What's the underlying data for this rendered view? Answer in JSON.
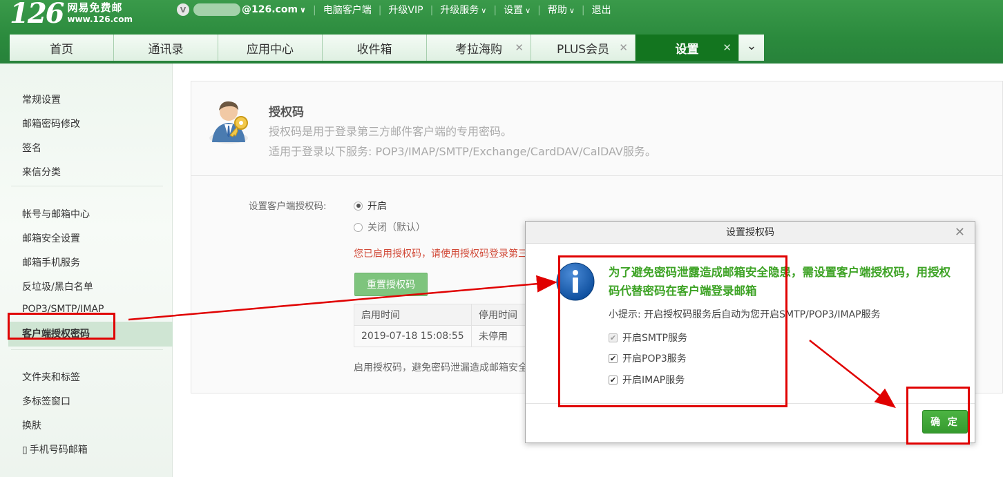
{
  "header": {
    "logo_number": "126",
    "logo_name": "网易免费邮",
    "logo_url": "www.126.com",
    "vip_badge": "V",
    "account_suffix": "@126.com",
    "links": [
      {
        "label": "电脑客户端",
        "dropdown": false
      },
      {
        "label": "升级VIP",
        "dropdown": false
      },
      {
        "label": "升级服务",
        "dropdown": true
      },
      {
        "label": "设置",
        "dropdown": true
      },
      {
        "label": "帮助",
        "dropdown": true
      },
      {
        "label": "退出",
        "dropdown": false
      }
    ]
  },
  "tabs": [
    {
      "label": "首页",
      "closable": false,
      "active": false
    },
    {
      "label": "通讯录",
      "closable": false,
      "active": false
    },
    {
      "label": "应用中心",
      "closable": false,
      "active": false
    },
    {
      "label": "收件箱",
      "closable": false,
      "active": false
    },
    {
      "label": "考拉海购",
      "closable": true,
      "active": false
    },
    {
      "label": "PLUS会员",
      "closable": true,
      "active": false
    },
    {
      "label": "设置",
      "closable": true,
      "active": true
    }
  ],
  "sidebar": {
    "groups": [
      [
        "常规设置",
        "邮箱密码修改",
        "签名",
        "来信分类"
      ],
      [
        "帐号与邮箱中心",
        "邮箱安全设置",
        "邮箱手机服务",
        "反垃圾/黑白名单",
        "POP3/SMTP/IMAP",
        "客户端授权密码"
      ],
      [
        "文件夹和标签",
        "多标签窗口",
        "换肤",
        "手机号码邮箱"
      ]
    ],
    "active_item": "客户端授权密码"
  },
  "panel": {
    "title": "授权码",
    "desc1": "授权码是用于登录第三方邮件客户端的专用密码。",
    "desc2": "适用于登录以下服务: POP3/IMAP/SMTP/Exchange/CardDAV/CalDAV服务。",
    "field_label": "设置客户端授权码:",
    "radio_on": "开启",
    "radio_off": "关闭（默认）",
    "selected": "开启",
    "warning": "您已启用授权码，请使用授权码登录第三方",
    "reset_button": "重置授权码",
    "table": {
      "headers": [
        "启用时间",
        "停用时间"
      ],
      "rows": [
        [
          "2019-07-18 15:08:55",
          "未停用"
        ]
      ]
    },
    "note": "启用授权码，避免密码泄漏造成邮箱安全隐患"
  },
  "dialog": {
    "title": "设置授权码",
    "message": "为了避免密码泄露造成邮箱安全隐患，需设置客户端授权码，用授权码代替密码在客户端登录邮箱",
    "tip": "小提示: 开启授权码服务后自动为您开启SMTP/POP3/IMAP服务",
    "options": [
      {
        "label": "开启SMTP服务",
        "checked": true,
        "disabled": true
      },
      {
        "label": "开启POP3服务",
        "checked": true,
        "disabled": false
      },
      {
        "label": "开启IMAP服务",
        "checked": true,
        "disabled": false
      }
    ],
    "confirm_button": "确 定"
  },
  "colors": {
    "brand_green": "#2b8a3d",
    "active_tab": "#13751f",
    "annotation_red": "#e00000",
    "message_green": "#3ea326"
  }
}
